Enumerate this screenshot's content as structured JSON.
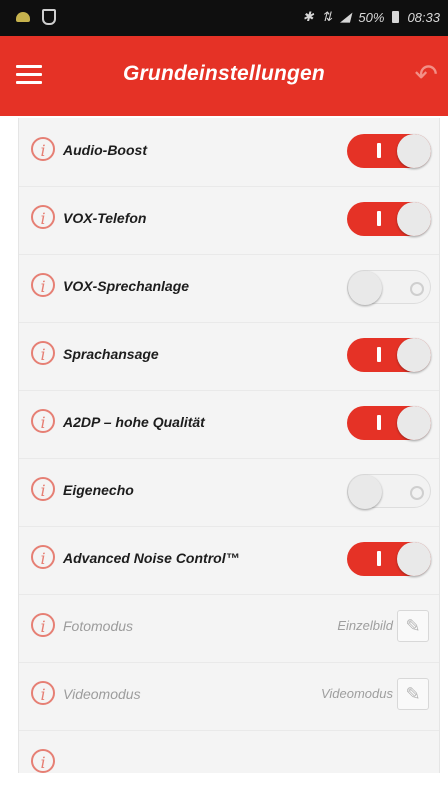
{
  "statusbar": {
    "battery": "50%",
    "time": "08:33",
    "icons": [
      "android-icon",
      "shield-icon",
      "bluetooth-icon",
      "network-icon",
      "signal-icon",
      "battery-icon"
    ]
  },
  "header": {
    "title": "Grundeinstellungen",
    "menu_icon": "menu-icon",
    "back_icon": "back-icon",
    "color": "#e53226"
  },
  "settings": [
    {
      "label": "Audio-Boost",
      "type": "toggle",
      "on": true
    },
    {
      "label": "VOX-Telefon",
      "type": "toggle",
      "on": true
    },
    {
      "label": "VOX-Sprechanlage",
      "type": "toggle",
      "on": false
    },
    {
      "label": "Sprachansage",
      "type": "toggle",
      "on": true
    },
    {
      "label": "A2DP – hohe Qualität",
      "type": "toggle",
      "on": true
    },
    {
      "label": "Eigenecho",
      "type": "toggle",
      "on": false
    },
    {
      "label": "Advanced Noise Control™",
      "type": "toggle",
      "on": true
    },
    {
      "label": "Fotomodus",
      "type": "value",
      "value": "Einzelbild"
    },
    {
      "label": "Videomodus",
      "type": "value",
      "value": "Videomodus"
    }
  ]
}
